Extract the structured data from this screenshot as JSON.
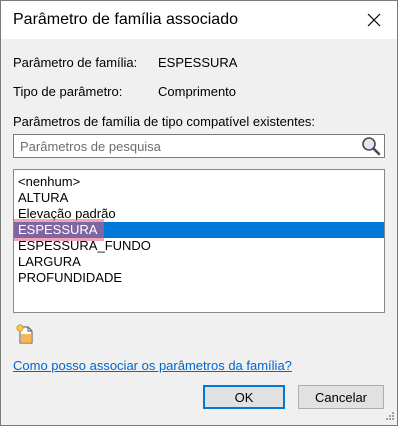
{
  "window": {
    "title": "Parâmetro de família associado"
  },
  "info": {
    "family_param_label": "Parâmetro de família:",
    "family_param_value": "ESPESSURA",
    "param_type_label": "Tipo de parâmetro:",
    "param_type_value": "Comprimento"
  },
  "compatible": {
    "label": "Parâmetros de família de tipo compatível existentes:",
    "search_placeholder": "Parâmetros de pesquisa",
    "items": [
      {
        "label": "<nenhum>",
        "selected": false
      },
      {
        "label": "ALTURA",
        "selected": false
      },
      {
        "label": "Elevação padrão",
        "selected": false
      },
      {
        "label": "ESPESSURA",
        "selected": true
      },
      {
        "label": "ESPESSURA_FUNDO",
        "selected": false
      },
      {
        "label": "LARGURA",
        "selected": false
      },
      {
        "label": "PROFUNDIDADE",
        "selected": false
      }
    ]
  },
  "help_link": "Como posso associar os parâmetros da família?",
  "buttons": {
    "ok": "OK",
    "cancel": "Cancelar"
  },
  "colors": {
    "selection": "#0078d7",
    "link": "#0066cc",
    "highlight": "#e85878"
  },
  "icons": {
    "close": "close-icon",
    "search": "search-icon",
    "new_parameter": "new-parameter-icon"
  }
}
